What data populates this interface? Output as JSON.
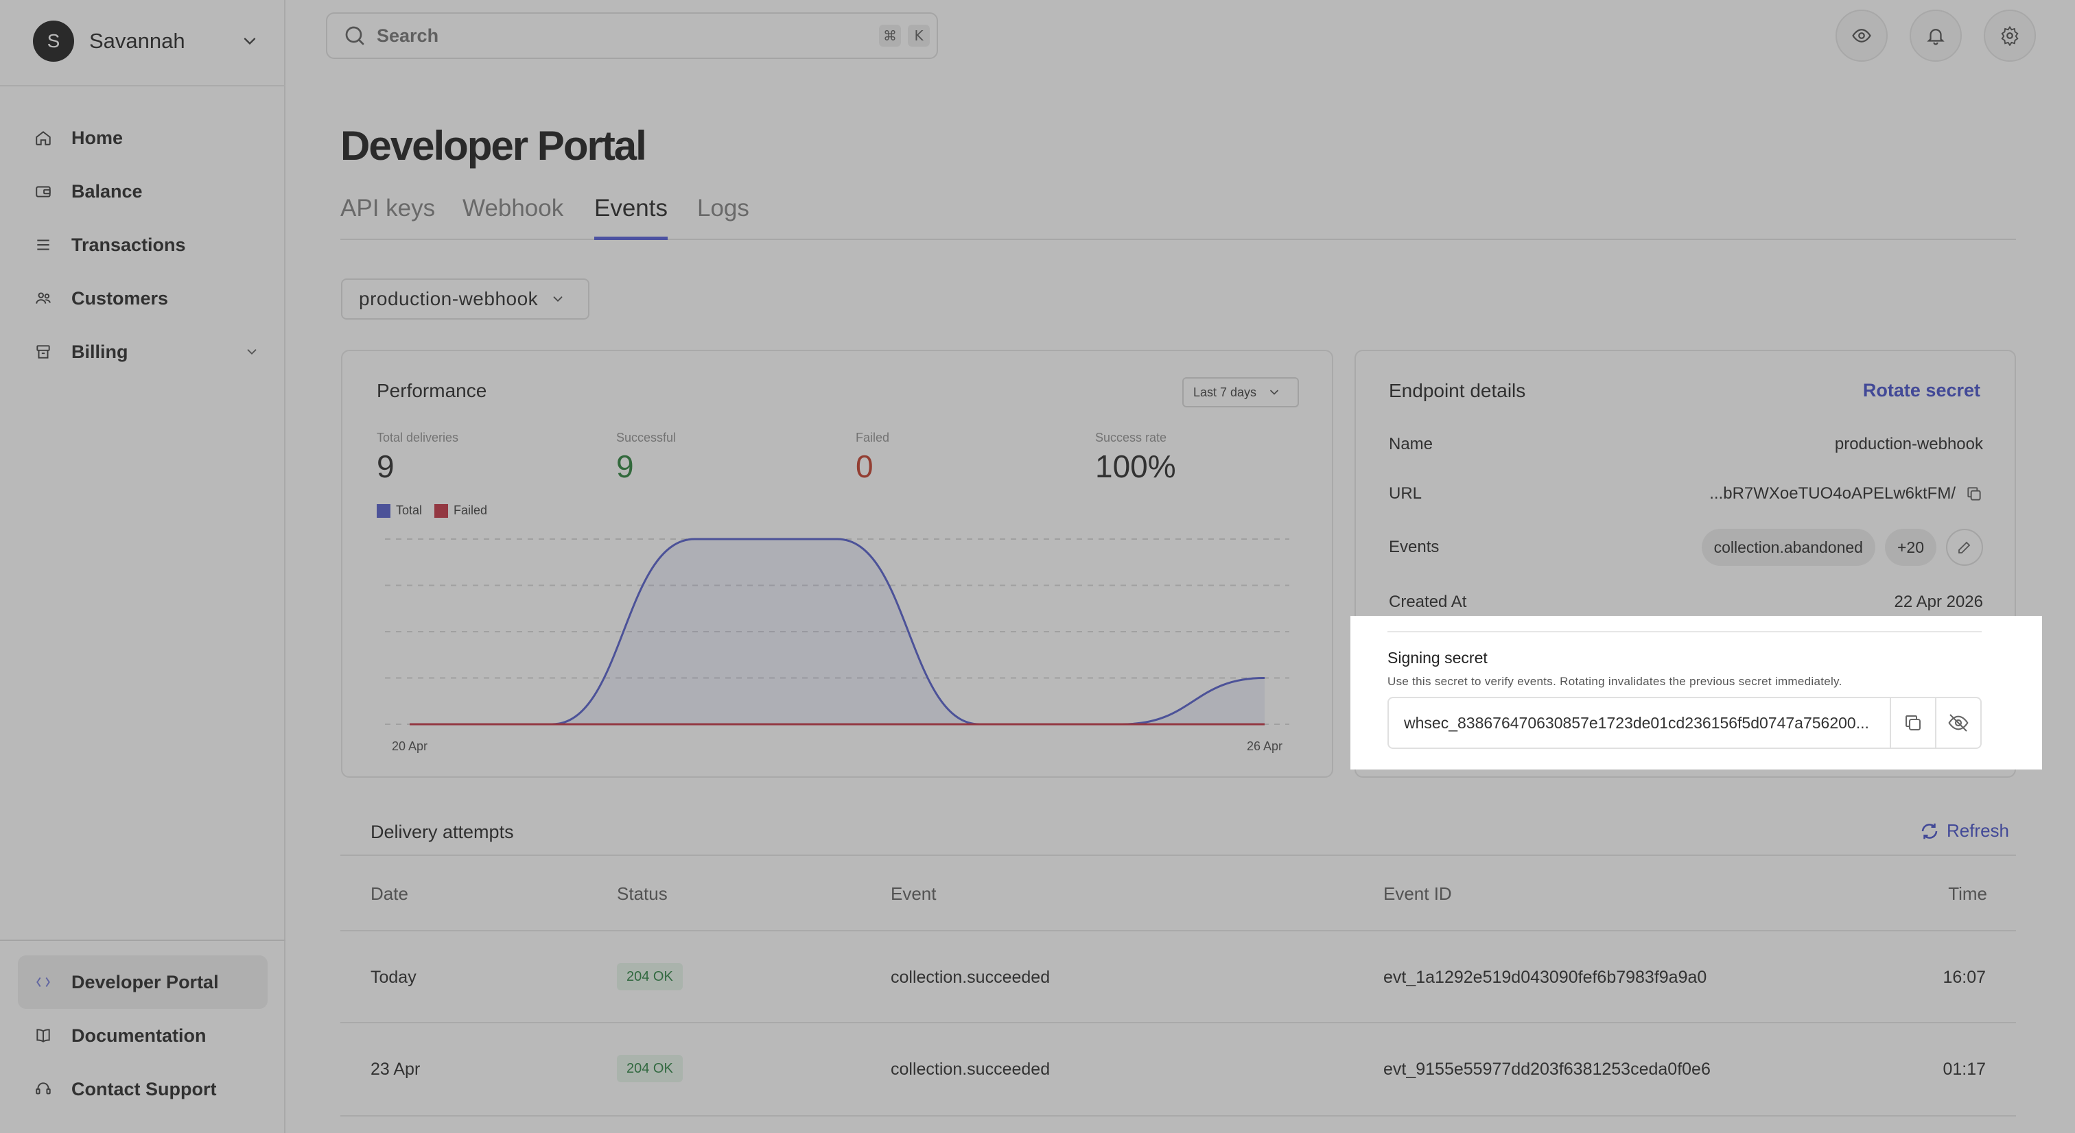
{
  "user": {
    "initial": "S",
    "name": "Savannah"
  },
  "nav": {
    "items": [
      {
        "label": "Home",
        "icon": "home-icon"
      },
      {
        "label": "Balance",
        "icon": "wallet-icon"
      },
      {
        "label": "Transactions",
        "icon": "list-icon"
      },
      {
        "label": "Customers",
        "icon": "users-icon"
      },
      {
        "label": "Billing",
        "icon": "billing-icon"
      }
    ],
    "bottom": [
      {
        "label": "Developer Portal",
        "icon": "code-icon"
      },
      {
        "label": "Documentation",
        "icon": "book-icon"
      },
      {
        "label": "Contact Support",
        "icon": "support-icon"
      }
    ]
  },
  "search": {
    "placeholder": "Search",
    "shortcut": [
      "⌘",
      "K"
    ]
  },
  "page": {
    "title": "Developer Portal"
  },
  "tabs": [
    "API keys",
    "Webhook",
    "Events",
    "Logs"
  ],
  "webhook_select": {
    "value": "production-webhook"
  },
  "performance": {
    "title": "Performance",
    "range": "Last 7 days",
    "stats": [
      {
        "label": "Total deliveries",
        "value": "9"
      },
      {
        "label": "Successful",
        "value": "9"
      },
      {
        "label": "Failed",
        "value": "0"
      },
      {
        "label": "Success rate",
        "value": "100%"
      }
    ],
    "legend": [
      "Total",
      "Failed"
    ]
  },
  "chart_data": {
    "type": "area",
    "x_labels": [
      "20 Apr",
      "26 Apr"
    ],
    "series": [
      {
        "name": "Total",
        "color": "#4a54c8",
        "values": [
          0,
          0,
          4,
          4,
          0,
          0,
          1
        ]
      },
      {
        "name": "Failed",
        "color": "#c0283a",
        "values": [
          0,
          0,
          0,
          0,
          0,
          0,
          0
        ]
      }
    ],
    "ylim": [
      0,
      4
    ],
    "grid": true
  },
  "endpoint": {
    "title": "Endpoint details",
    "rotate": "Rotate secret",
    "name_label": "Name",
    "name_value": "production-webhook",
    "url_label": "URL",
    "url_value": "...bR7WXoeTUO4oAPELw6ktFM/",
    "events_label": "Events",
    "events_chip": "collection.abandoned",
    "events_more": "+20",
    "created_label": "Created At",
    "created_value": "22 Apr 2026",
    "signing_title": "Signing secret",
    "signing_help": "Use this secret to verify events. Rotating invalidates the previous secret immediately.",
    "secret_value": "whsec_838676470630857e1723de01cd236156f5d0747a756200..."
  },
  "deliveries": {
    "title": "Delivery attempts",
    "refresh": "Refresh",
    "headers": [
      "Date",
      "Status",
      "Event",
      "Event ID",
      "Time"
    ],
    "rows": [
      {
        "date": "Today",
        "status": "204 OK",
        "event": "collection.succeeded",
        "event_id": "evt_1a1292e519d043090fef6b7983f9a9a0",
        "time": "16:07"
      },
      {
        "date": "23 Apr",
        "status": "204 OK",
        "event": "collection.succeeded",
        "event_id": "evt_9155e55977dd203f6381253ceda0f0e6",
        "time": "01:17"
      }
    ]
  }
}
